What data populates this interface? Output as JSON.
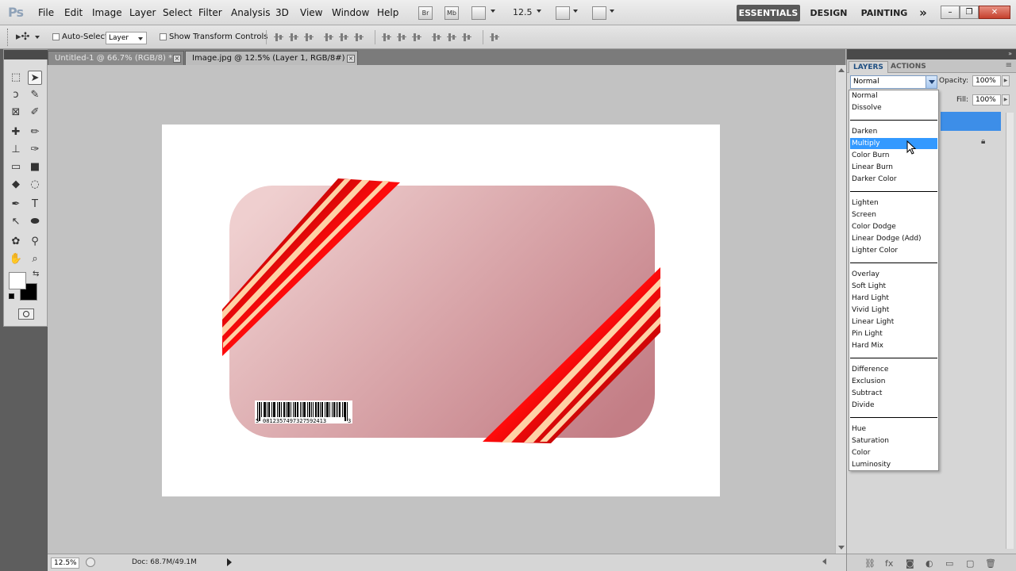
{
  "app": {
    "logo": "Ps"
  },
  "menu": [
    "File",
    "Edit",
    "Image",
    "Layer",
    "Select",
    "Filter",
    "Analysis",
    "3D",
    "View",
    "Window",
    "Help"
  ],
  "appbar": {
    "bridge": "Br",
    "mini_bridge": "Mb",
    "zoom": "12.5"
  },
  "workspaces": [
    "ESSENTIALS",
    "DESIGN",
    "PAINTING",
    "»"
  ],
  "window_buttons": [
    "–",
    "❐",
    "✕"
  ],
  "options": {
    "auto_select_label": "Auto-Select:",
    "auto_select_value": "Layer",
    "transform_label": "Show Transform Controls"
  },
  "tabs": [
    {
      "label": "Untitled-1 @ 66.7% (RGB/8) *",
      "active": false
    },
    {
      "label": "Image.jpg @ 12.5% (Layer 1, RGB/8#) *",
      "active": true
    }
  ],
  "status": {
    "zoom": "12.5%",
    "doc": "Doc: 68.7M/49.1M"
  },
  "document": {
    "barcode_number": "0812357497327592413",
    "barcode_left_digit": "5",
    "barcode_right_digit": "3"
  },
  "layers_panel": {
    "tabs": [
      "LAYERS",
      "ACTIONS"
    ],
    "blend_mode": "Normal",
    "opacity_label": "Opacity:",
    "opacity_value": "100%",
    "fill_label": "Fill:",
    "fill_value": "100%"
  },
  "blend_modes": {
    "selected": "Multiply",
    "groups": [
      [
        "Normal",
        "Dissolve"
      ],
      [
        "Darken",
        "Multiply",
        "Color Burn",
        "Linear Burn",
        "Darker Color"
      ],
      [
        "Lighten",
        "Screen",
        "Color Dodge",
        "Linear Dodge (Add)",
        "Lighter Color"
      ],
      [
        "Overlay",
        "Soft Light",
        "Hard Light",
        "Vivid Light",
        "Linear Light",
        "Pin Light",
        "Hard Mix"
      ],
      [
        "Difference",
        "Exclusion",
        "Subtract",
        "Divide"
      ],
      [
        "Hue",
        "Saturation",
        "Color",
        "Luminosity"
      ]
    ]
  },
  "icons": {
    "toolbox": [
      "marquee-icon",
      "move-icon",
      "lasso-icon",
      "quick-selection-icon",
      "crop-icon",
      "eyedropper-icon",
      "healing-brush-icon",
      "brush-icon",
      "clone-stamp-icon",
      "history-brush-icon",
      "eraser-icon",
      "gradient-icon",
      "blur-icon",
      "dodge-icon",
      "pen-icon",
      "type-icon",
      "path-selection-icon",
      "ellipse-icon",
      "3d-rotate-icon",
      "3d-orbit-icon",
      "hand-icon",
      "zoom-icon"
    ],
    "panel_footer": [
      "link-layers-icon",
      "fx-icon",
      "mask-icon",
      "adjustment-icon",
      "group-icon",
      "new-layer-icon",
      "trash-icon"
    ]
  },
  "colors": {
    "accent": "#3d8ee8",
    "ribbon": "#d40000",
    "card_light": "#efcfcf",
    "card_dark": "#c37d85"
  }
}
